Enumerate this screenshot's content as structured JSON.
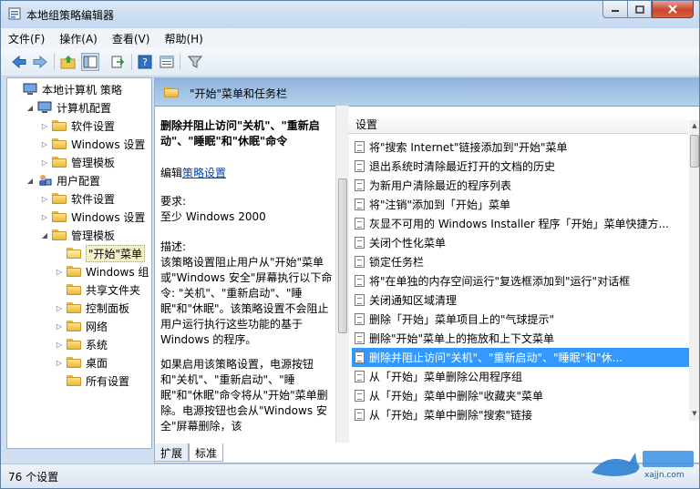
{
  "window": {
    "title": "本地组策略编辑器"
  },
  "menu": [
    "文件(F)",
    "操作(A)",
    "查看(V)",
    "帮助(H)"
  ],
  "tree": [
    {
      "label": "本地计算机 策略",
      "indent": 0,
      "icon": "computer-icon",
      "toggle": ""
    },
    {
      "label": "计算机配置",
      "indent": 1,
      "icon": "computer-icon",
      "toggle": "open"
    },
    {
      "label": "软件设置",
      "indent": 2,
      "icon": "folder-icon",
      "toggle": "closed"
    },
    {
      "label": "Windows 设置",
      "indent": 2,
      "icon": "folder-icon",
      "toggle": "closed"
    },
    {
      "label": "管理模板",
      "indent": 2,
      "icon": "folder-icon",
      "toggle": "closed"
    },
    {
      "label": "用户配置",
      "indent": 1,
      "icon": "user-icon",
      "toggle": "open"
    },
    {
      "label": "软件设置",
      "indent": 2,
      "icon": "folder-icon",
      "toggle": "closed"
    },
    {
      "label": "Windows 设置",
      "indent": 2,
      "icon": "folder-icon",
      "toggle": "closed"
    },
    {
      "label": "管理模板",
      "indent": 2,
      "icon": "folder-icon",
      "toggle": "open"
    },
    {
      "label": "\"开始\"菜单",
      "indent": 3,
      "icon": "folder-open-icon",
      "toggle": "",
      "selected": true
    },
    {
      "label": "Windows 组",
      "indent": 3,
      "icon": "folder-icon",
      "toggle": "closed"
    },
    {
      "label": "共享文件夹",
      "indent": 3,
      "icon": "folder-icon",
      "toggle": ""
    },
    {
      "label": "控制面板",
      "indent": 3,
      "icon": "folder-icon",
      "toggle": "closed"
    },
    {
      "label": "网络",
      "indent": 3,
      "icon": "folder-icon",
      "toggle": "closed"
    },
    {
      "label": "系统",
      "indent": 3,
      "icon": "folder-icon",
      "toggle": "closed"
    },
    {
      "label": "桌面",
      "indent": 3,
      "icon": "folder-icon",
      "toggle": "closed"
    },
    {
      "label": "所有设置",
      "indent": 3,
      "icon": "folder-settings-icon",
      "toggle": ""
    }
  ],
  "pane": {
    "title": "\"开始\"菜单和任务栏"
  },
  "desc": {
    "heading": "删除并阻止访问\"关机\"、\"重新启动\"、\"睡眠\"和\"休眠\"命令",
    "edit_prefix": "编辑",
    "edit_link": "策略设置",
    "req_label": "要求:",
    "req_value": "至少 Windows 2000",
    "desc_label": "描述:",
    "desc_body": "该策略设置阻止用户从\"开始\"菜单或\"Windows 安全\"屏幕执行以下命令: \"关机\"、\"重新启动\"、\"睡眠\"和\"休眠\"。该策略设置不会阻止用户运行执行这些功能的基于 Windows 的程序。",
    "desc_more": "如果启用该策略设置，电源按钮和\"关机\"、\"重新启动\"、\"睡眠\"和\"休眠\"命令将从\"开始\"菜单删除。电源按钮也会从\"Windows 安全\"屏幕删除，该"
  },
  "list": {
    "header": "设置",
    "rows": [
      "将\"搜索 Internet\"链接添加到\"开始\"菜单",
      "退出系统时清除最近打开的文档的历史",
      "为新用户清除最近的程序列表",
      "将\"注销\"添加到「开始」菜单",
      "灰显不可用的 Windows Installer 程序「开始」菜单快捷方...",
      "关闭个性化菜单",
      "锁定任务栏",
      "将\"在单独的内存空间运行\"复选框添加到\"运行\"对话框",
      "关闭通知区域清理",
      "删除「开始」菜单项目上的\"气球提示\"",
      "删除\"开始\"菜单上的拖放和上下文菜单",
      "删除并阻止访问\"关机\"、\"重新启动\"、\"睡眠\"和\"休...",
      "从「开始」菜单删除公用程序组",
      "从「开始」菜单中删除\"收藏夹\"菜单",
      "从「开始」菜单中删除\"搜索\"链接"
    ],
    "selected_index": 11
  },
  "tabs": [
    "扩展",
    "标准"
  ],
  "status": {
    "text": "76 个设置"
  },
  "watermark": {
    "text": "xajjn.com"
  }
}
